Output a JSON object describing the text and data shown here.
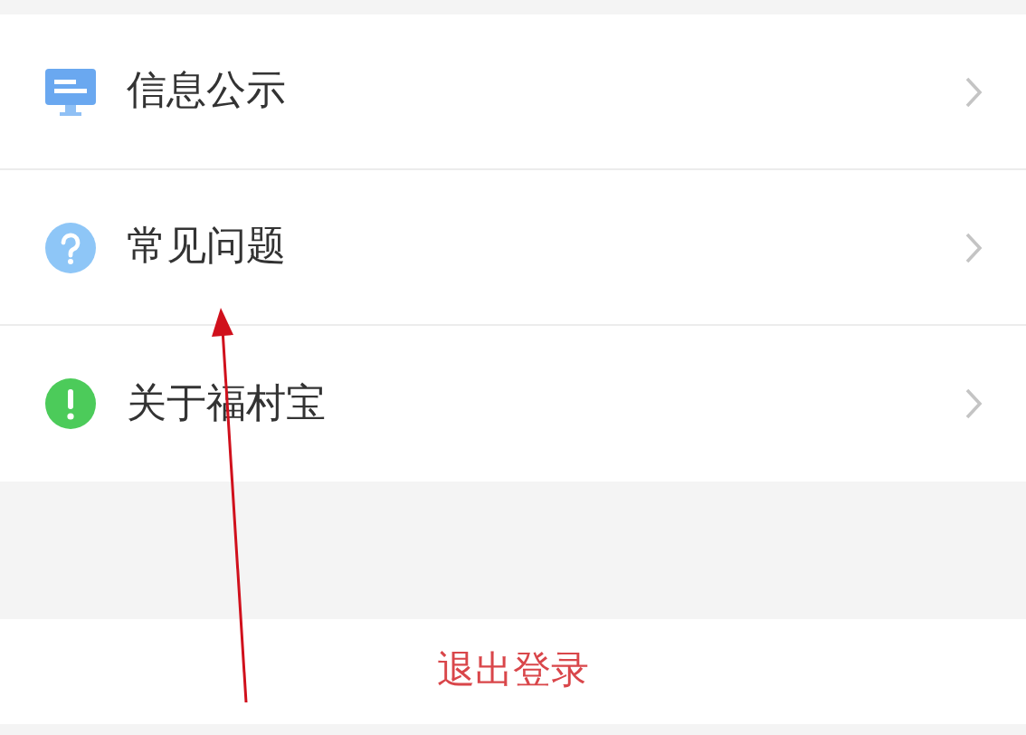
{
  "menu_items": [
    {
      "label": "信息公示"
    },
    {
      "label": "常见问题"
    },
    {
      "label": "关于福村宝"
    }
  ],
  "logout_button": {
    "label": "退出登录"
  }
}
